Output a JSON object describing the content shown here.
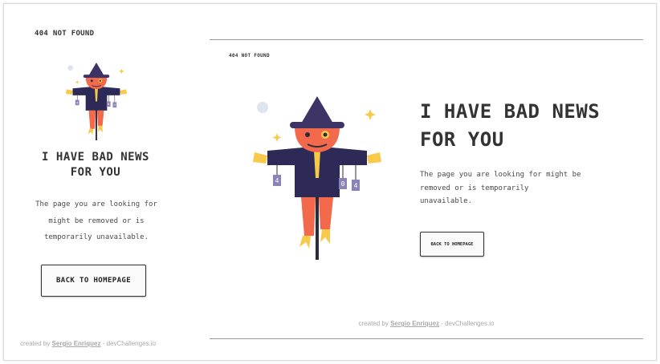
{
  "mobile": {
    "not_found_label": "404 NOT FOUND",
    "title_line1": "I HAVE BAD NEWS",
    "title_line2": "FOR YOU",
    "desc_line1": "The page you are looking for",
    "desc_line2": "might be removed or is",
    "desc_line3": "temporarily unavailable.",
    "button_label": "BACK TO HOMEPAGE",
    "footer": {
      "prefix": "created by ",
      "author": "Sergio Enriquez",
      "suffix": " - devChallenges.io"
    }
  },
  "desktop": {
    "not_found_label": "404 NOT FOUND",
    "title_line1": "I HAVE BAD NEWS",
    "title_line2": "FOR YOU",
    "desc_line1": "The page you are looking for might be",
    "desc_line2": "removed or is temporarily",
    "desc_line3": "unavailable.",
    "button_label": "BACK TO HOMEPAGE",
    "footer": {
      "prefix": "created by ",
      "author": "Sergio Enriquez",
      "suffix": " - devChallenges.io"
    }
  },
  "illustration": {
    "name": "scarecrow-illustration",
    "tag_left": "4",
    "tag_right_1": "0",
    "tag_right_2": "4",
    "colors": {
      "hat": "#3d3365",
      "coat": "#2e2a57",
      "face": "#f2694b",
      "straw": "#f8c94a",
      "tie": "#f7c948",
      "pants": "#f2694b",
      "pole": "#2b2b3b",
      "tag": "#8a83b5",
      "sparkle": "#f8c94a",
      "moon": "#dfe3ee"
    }
  }
}
